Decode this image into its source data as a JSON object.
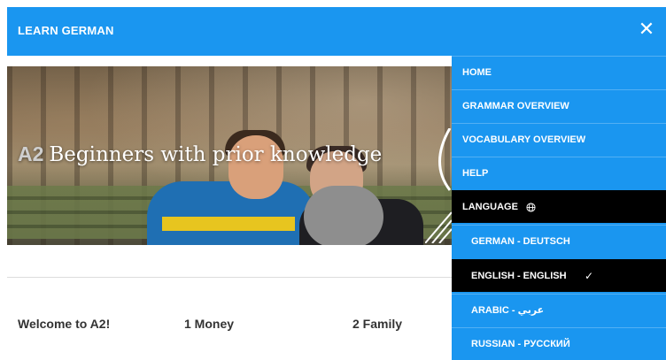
{
  "header": {
    "title": "LEARN GERMAN",
    "close_icon": "close-icon"
  },
  "hero": {
    "level": "A2",
    "headline": "Beginners with prior knowledge"
  },
  "tabs": [
    {
      "label": "Welcome to A2!"
    },
    {
      "label": "1 Money"
    },
    {
      "label": "2 Family"
    }
  ],
  "menu": {
    "items": [
      {
        "label": "HOME"
      },
      {
        "label": "GRAMMAR OVERVIEW"
      },
      {
        "label": "VOCABULARY OVERVIEW"
      },
      {
        "label": "HELP"
      },
      {
        "label": "LANGUAGE",
        "icon": "globe-icon"
      }
    ],
    "languages": [
      {
        "label": "GERMAN - DEUTSCH",
        "selected": false
      },
      {
        "label": "ENGLISH - ENGLISH",
        "selected": true,
        "check": "✓"
      },
      {
        "label": "ARABIC - عربي",
        "selected": false
      },
      {
        "label": "RUSSIAN - РУССКИЙ",
        "selected": false
      }
    ]
  },
  "colors": {
    "brand_blue": "#1a96f0",
    "selected_bg": "#000000"
  }
}
